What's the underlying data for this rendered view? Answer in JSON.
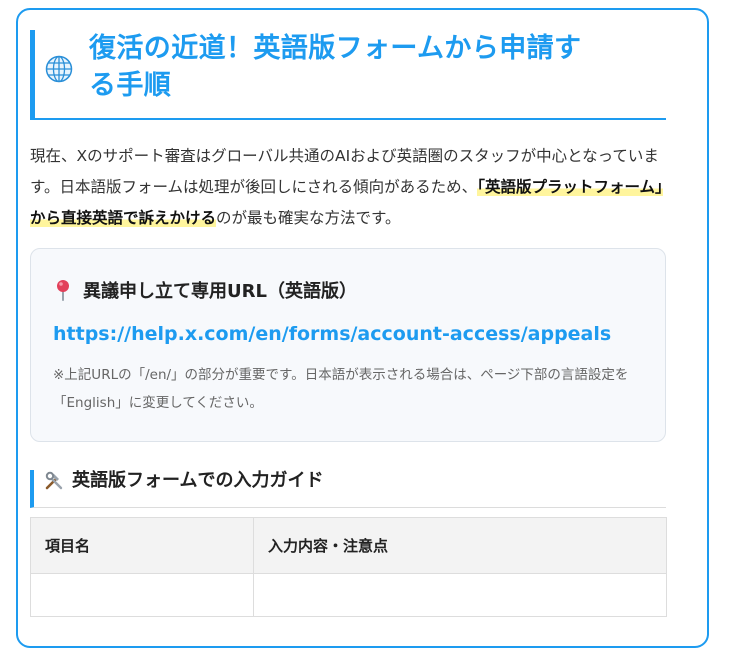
{
  "section": {
    "heading_line1": "復活の近道！英語版フォームから申請す",
    "heading_line2": "る手順",
    "intro_before": "現在、Xのサポート審査はグローバル共通のAIおよび英語圏のスタッフが中心となっています。日本語版フォームは処理が後回しにされる傾向があるため、",
    "intro_highlight": "「英語版プラットフォーム」から直接英語で訴えかける",
    "intro_after": "のが最も確実な方法です。"
  },
  "url_box": {
    "title": "異議申し立て専用URL（英語版）",
    "url": "https://help.x.com/en/forms/account-access/appeals",
    "note": "※上記URLの「/en/」の部分が重要です。日本語が表示される場合は、ページ下部の言語設定を「English」に変更してください。"
  },
  "guide": {
    "title": "英語版フォームでの入力ガイド",
    "col_item": "項目名",
    "col_content": "入力内容・注意点"
  },
  "colors": {
    "accent": "#1d9bf0",
    "highlight": "#fff59d",
    "box_bg": "#f7f9fc"
  },
  "icons": [
    "globe-icon",
    "pin-icon",
    "tools-icon"
  ]
}
